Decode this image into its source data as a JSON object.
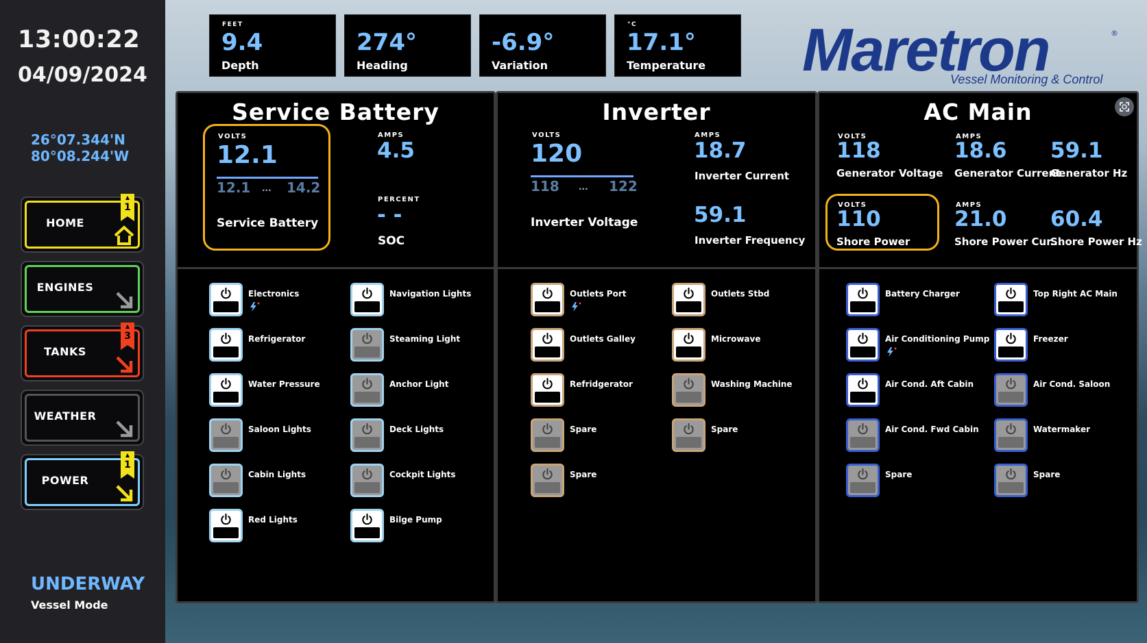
{
  "sidebar": {
    "time": "13:00:22",
    "date": "04/09/2024",
    "latitude": "26°07.344'N",
    "longitude": "80°08.244'W",
    "nav": [
      {
        "label": "HOME",
        "color": "#f2e21c",
        "badge": "1",
        "badge_color": "#f2e21c",
        "icon": "home-icon"
      },
      {
        "label": "ENGINES",
        "color": "#5fd35a",
        "badge": null,
        "icon": "arrow-down-right-icon",
        "icon_color": "#9a9a9a"
      },
      {
        "label": "TANKS",
        "color": "#f04020",
        "badge": "3",
        "badge_color": "#f04020",
        "icon": "arrow-down-right-icon",
        "icon_color": "#f04020"
      },
      {
        "label": "WEATHER",
        "color": "#555555",
        "badge": null,
        "icon": "arrow-down-right-icon",
        "icon_color": "#9a9a9a"
      },
      {
        "label": "POWER",
        "color": "#7fd0ff",
        "badge": "1",
        "badge_color": "#f2e21c",
        "icon": "arrow-down-right-icon",
        "icon_color": "#f2e21c"
      }
    ],
    "vessel_mode": "UNDERWAY",
    "vessel_mode_label": "Vessel Mode"
  },
  "tiles": [
    {
      "unit": "FEET",
      "value": "9.4",
      "label": "Depth"
    },
    {
      "unit": "",
      "value": "274°",
      "label": "Heading"
    },
    {
      "unit": "",
      "value": "-6.9°",
      "label": "Variation"
    },
    {
      "unit": "°C",
      "value": "17.1°",
      "label": "Temperature"
    }
  ],
  "brand": {
    "name": "Maretron",
    "registered": "®",
    "tagline": "Vessel Monitoring & Control",
    "color": "#1d3a8a"
  },
  "panels": {
    "battery": {
      "title": "Service Battery",
      "volts_unit": "VOLTS",
      "volts": "12.1",
      "range_min": "12.1",
      "range_max": "14.2",
      "range_dots": "...",
      "volts_label": "Service Battery",
      "amps_unit": "AMPS",
      "amps": "4.5",
      "soc_unit": "PERCENT",
      "soc": "- -",
      "soc_label": "SOC"
    },
    "inverter": {
      "title": "Inverter",
      "volts_unit": "VOLTS",
      "volts": "120",
      "range_min": "118",
      "range_max": "122",
      "range_dots": "...",
      "volts_label": "Inverter Voltage",
      "amps_unit": "AMPS",
      "amps": "18.7",
      "amps_label": "Inverter Current",
      "freq": "59.1",
      "freq_label": "Inverter Frequency"
    },
    "ac": {
      "title": "AC Main",
      "gen_v_unit": "VOLTS",
      "gen_v": "118",
      "gen_v_label": "Generator Voltage",
      "gen_a_unit": "AMPS",
      "gen_a": "18.6",
      "gen_a_label": "Generator Current",
      "gen_hz": "59.1",
      "gen_hz_label": "Generator Hz",
      "shore_v_unit": "VOLTS",
      "shore_v": "110",
      "shore_v_label": "Shore Power",
      "shore_a_unit": "AMPS",
      "shore_a": "21.0",
      "shore_a_label": "Shore Power Cur...",
      "shore_hz": "60.4",
      "shore_hz_label": "Shore Power Hz"
    }
  },
  "switches": {
    "battery": {
      "border": "#9fd3f0",
      "items": [
        {
          "label": "Electronics",
          "on": true,
          "bolt": true
        },
        {
          "label": "Navigation Lights",
          "on": true,
          "bolt": false
        },
        {
          "label": "Refrigerator",
          "on": true,
          "bolt": false
        },
        {
          "label": "Steaming Light",
          "on": false,
          "bolt": false
        },
        {
          "label": "Water Pressure",
          "on": true,
          "bolt": false
        },
        {
          "label": "Anchor Light",
          "on": false,
          "bolt": false
        },
        {
          "label": "Saloon Lights",
          "on": false,
          "bolt": false
        },
        {
          "label": "Deck Lights",
          "on": false,
          "bolt": false
        },
        {
          "label": "Cabin Lights",
          "on": false,
          "bolt": false
        },
        {
          "label": "Cockpit Lights",
          "on": false,
          "bolt": false
        },
        {
          "label": "Red Lights",
          "on": true,
          "bolt": false
        },
        {
          "label": "Bilge Pump",
          "on": true,
          "bolt": false
        }
      ]
    },
    "inverter": {
      "border": "#c9a57a",
      "items": [
        {
          "label": "Outlets Port",
          "on": true,
          "bolt": true
        },
        {
          "label": "Outlets Stbd",
          "on": true,
          "bolt": false
        },
        {
          "label": "Outlets Galley",
          "on": true,
          "bolt": false
        },
        {
          "label": "Microwave",
          "on": true,
          "bolt": false
        },
        {
          "label": "Refridgerator",
          "on": true,
          "bolt": false
        },
        {
          "label": "Washing Machine",
          "on": false,
          "bolt": false
        },
        {
          "label": "Spare",
          "on": false,
          "bolt": false
        },
        {
          "label": "Spare",
          "on": false,
          "bolt": false
        },
        {
          "label": "Spare",
          "on": false,
          "bolt": false
        }
      ]
    },
    "ac": {
      "border": "#3a5fd0",
      "items": [
        {
          "label": "Battery Charger",
          "on": true,
          "bolt": false
        },
        {
          "label": "Top Right AC Main",
          "on": true,
          "bolt": false
        },
        {
          "label": "Air Conditioning Pump",
          "on": true,
          "bolt": true
        },
        {
          "label": "Freezer",
          "on": true,
          "bolt": false
        },
        {
          "label": "Air Cond. Aft Cabin",
          "on": true,
          "bolt": false
        },
        {
          "label": "Air Cond. Saloon",
          "on": false,
          "bolt": false
        },
        {
          "label": "Air Cond. Fwd Cabin",
          "on": false,
          "bolt": false
        },
        {
          "label": "Watermaker",
          "on": false,
          "bolt": false
        },
        {
          "label": "Spare",
          "on": false,
          "bolt": false
        },
        {
          "label": "Spare",
          "on": false,
          "bolt": false
        }
      ]
    }
  }
}
